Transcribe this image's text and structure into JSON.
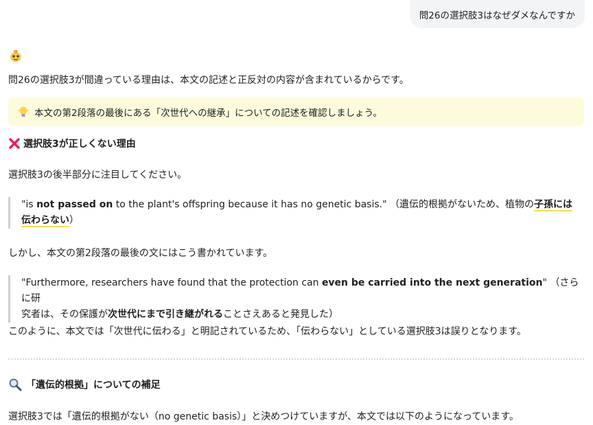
{
  "user_message": "問26の選択肢3はなぜダメなんですか",
  "answer": {
    "intro": "問26の選択肢3が間違っている理由は、本文の記述と正反対の内容が含まれているからです。",
    "tip": "本文の第2段落の最後にある「次世代への継承」についての記述を確認しましょう。",
    "heading1": "選択肢3が正しくない理由",
    "p1": "選択肢3の後半部分に注目してください。",
    "quote1": {
      "a": "\"is ",
      "b": "not passed on",
      "c": " to the plant's offspring because it has no genetic basis.\" （遺伝的根拠がないため、植物の",
      "d": "子孫には",
      "e": "伝わらない",
      "f": "）"
    },
    "p2": "しかし、本文の第2段落の最後の文にはこう書かれています。",
    "quote2": {
      "a": "\"Furthermore, researchers have found that the protection can ",
      "b": "even be carried into the next generation",
      "c": "\" （さらに研",
      "d": "究者は、その保護が",
      "e": "次世代にまで引き継がれる",
      "f": "ことさえあると発見した）"
    },
    "p3": "このように、本文では「次世代に伝わる」と明記されているため、「伝わらない」としている選択肢3は誤りとなります。",
    "heading2": "「遺伝的根拠」についての補足",
    "p4": "選択肢3では「遺伝的根拠がない（no genetic basis）」と決めつけていますが、本文では以下のようになっています。"
  },
  "icons": {
    "avatar": "assistant-avatar-icon",
    "tip": "lightbulb-icon",
    "heading1": "cross-mark-icon",
    "heading2": "magnifier-icon"
  },
  "colors": {
    "tip_bg": "#fdfbdc",
    "highlight": "#f4e04d",
    "cross": "#e0245e",
    "user_bubble": "#f3f4f6"
  }
}
